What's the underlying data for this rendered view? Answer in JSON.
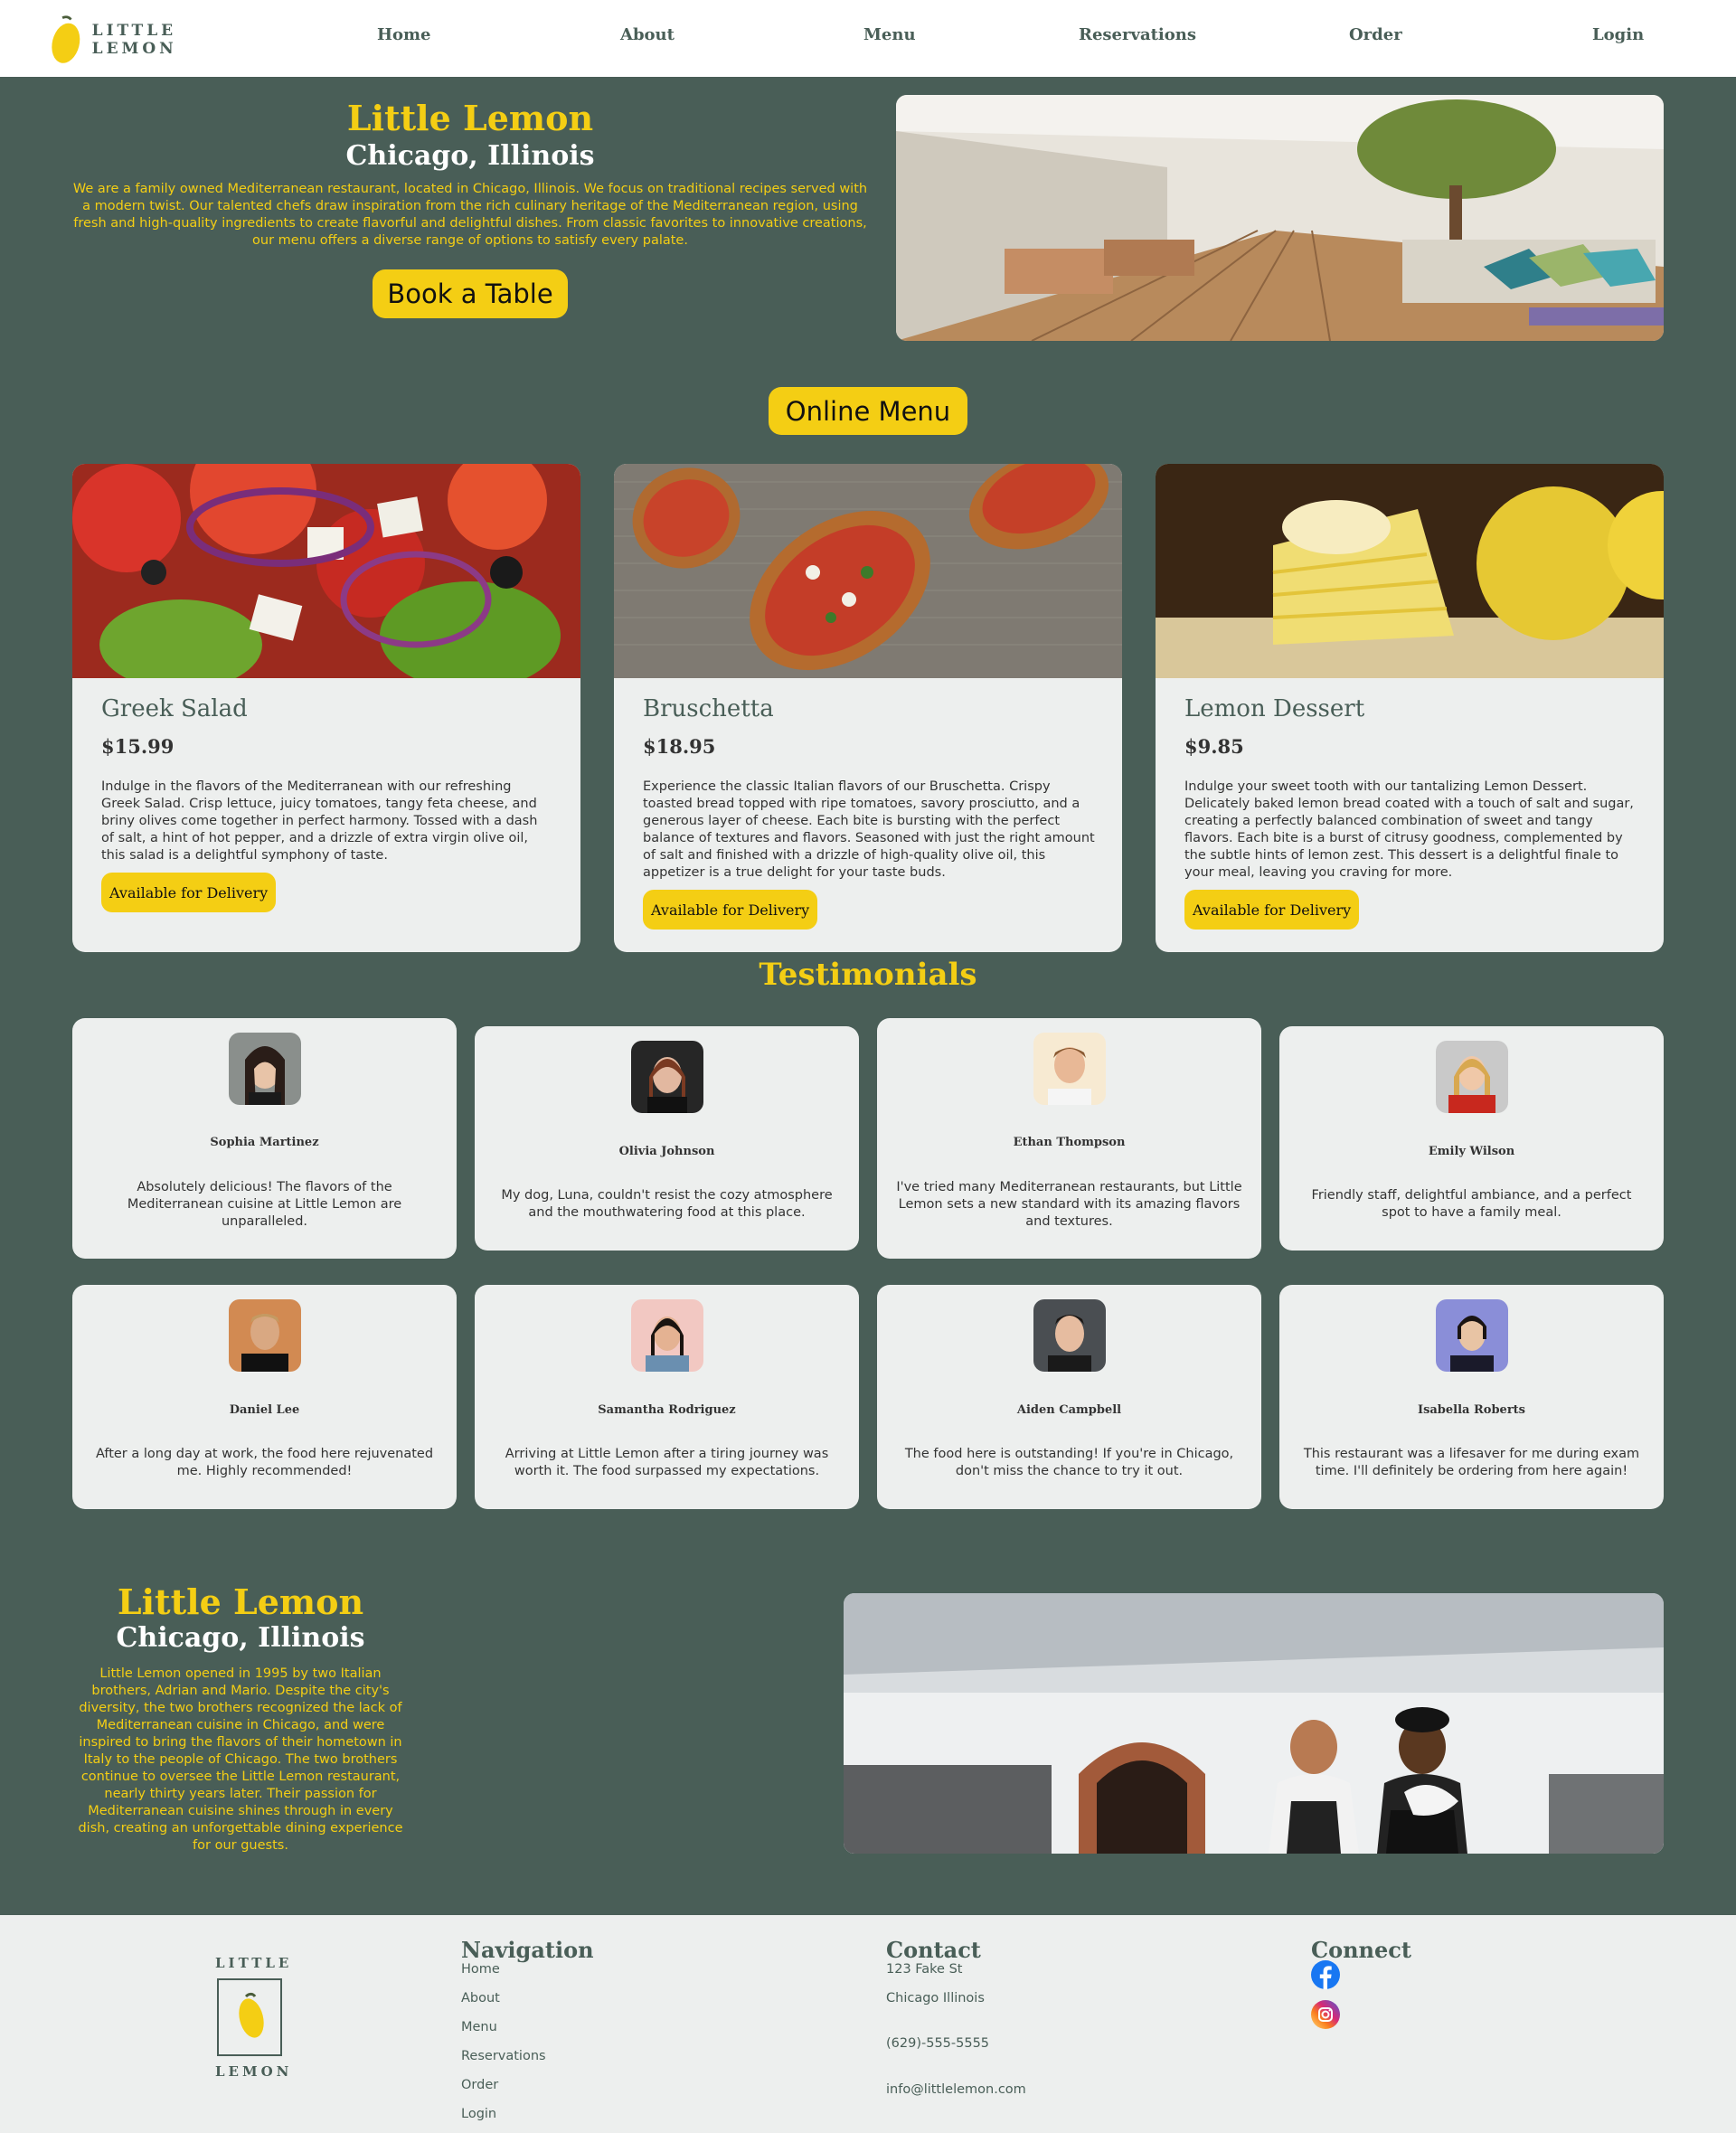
{
  "nav": {
    "logo_text": "LITTLE LEMON",
    "links": [
      "Home",
      "About",
      "Menu",
      "Reservations",
      "Order",
      "Login"
    ]
  },
  "hero": {
    "title": "Little Lemon",
    "subtitle": "Chicago, Illinois",
    "description": "We are a family owned Mediterranean restaurant, located in Chicago, Illinois. We focus on traditional recipes served with a modern twist. Our talented chefs draw inspiration from the rich culinary heritage of the Mediterranean region, using fresh and high-quality ingredients to create flavorful and delightful dishes. From classic favorites to innovative creations, our menu offers a diverse range of options to satisfy every palate.",
    "button": "Book a Table"
  },
  "menu": {
    "button": "Online Menu",
    "items": [
      {
        "title": "Greek Salad",
        "price": "$15.99",
        "description": "Indulge in the flavors of the Mediterranean with our refreshing Greek Salad. Crisp lettuce, juicy tomatoes, tangy feta cheese, and briny olives come together in perfect harmony. Tossed with a dash of salt, a hint of hot pepper, and a drizzle of extra virgin olive oil, this salad is a delightful symphony of taste.",
        "button": "Available for Delivery"
      },
      {
        "title": "Bruschetta",
        "price": "$18.95",
        "description": "Experience the classic Italian flavors of our Bruschetta. Crispy toasted bread topped with ripe tomatoes, savory prosciutto, and a generous layer of cheese. Each bite is bursting with the perfect balance of textures and flavors. Seasoned with just the right amount of salt and finished with a drizzle of high-quality olive oil, this appetizer is a true delight for your taste buds.",
        "button": "Available for Delivery"
      },
      {
        "title": "Lemon Dessert",
        "price": "$9.85",
        "description": "Indulge your sweet tooth with our tantalizing Lemon Dessert. Delicately baked lemon bread coated with a touch of salt and sugar, creating a perfectly balanced combination of sweet and tangy flavors. Each bite is a burst of citrusy goodness, complemented by the subtle hints of lemon zest. This dessert is a delightful finale to your meal, leaving you craving for more.",
        "button": "Available for Delivery"
      }
    ]
  },
  "testimonials": {
    "title": "Testimonials",
    "items": [
      {
        "name": "Sophia Martinez",
        "text": "Absolutely delicious! The flavors of the Mediterranean cuisine at Little Lemon are unparalleled."
      },
      {
        "name": "Olivia Johnson",
        "text": "My dog, Luna, couldn't resist the cozy atmosphere and the mouthwatering food at this place."
      },
      {
        "name": "Ethan Thompson",
        "text": "I've tried many Mediterranean restaurants, but Little Lemon sets a new standard with its amazing flavors and textures."
      },
      {
        "name": "Emily Wilson",
        "text": "Friendly staff, delightful ambiance, and a perfect spot to have a family meal."
      },
      {
        "name": "Daniel Lee",
        "text": "After a long day at work, the food here rejuvenated me. Highly recommended!"
      },
      {
        "name": "Samantha Rodriguez",
        "text": "Arriving at Little Lemon after a tiring journey was worth it. The food surpassed my expectations."
      },
      {
        "name": "Aiden Campbell",
        "text": "The food here is outstanding! If you're in Chicago, don't miss the chance to try it out."
      },
      {
        "name": "Isabella Roberts",
        "text": "This restaurant was a lifesaver for me during exam time. I'll definitely be ordering from here again!"
      }
    ]
  },
  "about": {
    "title": "Little Lemon",
    "subtitle": "Chicago, Illinois",
    "description": "Little Lemon opened in 1995 by two Italian brothers, Adrian and Mario. Despite the city's diversity, the two brothers recognized the lack of Mediterranean cuisine in Chicago, and were inspired to bring the flavors of their hometown in Italy to the people of Chicago. The two brothers continue to oversee the Little Lemon restaurant, nearly thirty years later. Their passion for Mediterranean cuisine shines through in every dish, creating an unforgettable dining experience for our guests."
  },
  "footer": {
    "logo_top": "LITTLE",
    "logo_bottom": "LEMON",
    "navigation": {
      "title": "Navigation",
      "links": [
        "Home",
        "About",
        "Menu",
        "Reservations",
        "Order",
        "Login"
      ]
    },
    "contact": {
      "title": "Contact",
      "lines": [
        "123 Fake St",
        "Chicago Illinois",
        "(629)-555-5555",
        "info@littlelemon.com"
      ]
    },
    "connect": {
      "title": "Connect",
      "icons": [
        "facebook-icon",
        "instagram-icon"
      ]
    }
  },
  "colors": {
    "primary_green": "#495E57",
    "primary_yellow": "#F4CE14",
    "card_bg": "#EDEFEE"
  }
}
